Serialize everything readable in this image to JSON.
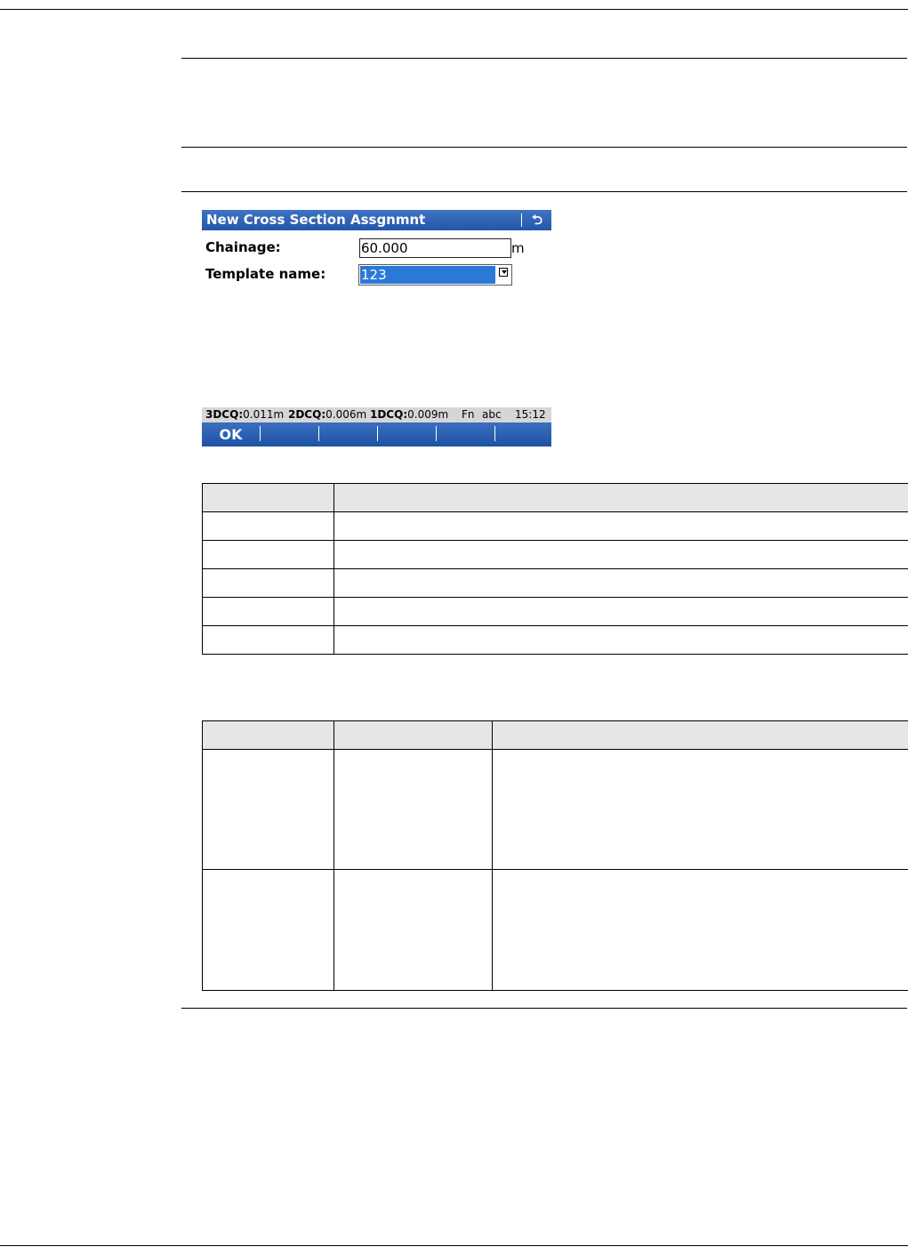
{
  "dialog": {
    "title": "New Cross Section Assgnmnt",
    "back_icon": "return-icon",
    "back_glyph": "⮌"
  },
  "fields": {
    "chainage": {
      "label": "Chainage:",
      "value": "60.000",
      "unit": "m"
    },
    "template_name": {
      "label": "Template name:",
      "value": "123",
      "dropdown_icon": "dropdown-arrow-icon"
    }
  },
  "status_bar": {
    "q3d_label": "3DCQ:",
    "q3d_value": "0.011m",
    "q2d_label": "2DCQ:",
    "q2d_value": "0.006m",
    "q1d_label": "1DCQ:",
    "q1d_value": "0.009m",
    "fn": "Fn",
    "input_mode": "abc",
    "time": "15:12"
  },
  "softkeys": [
    {
      "label": "OK"
    },
    {
      "label": ""
    },
    {
      "label": ""
    },
    {
      "label": ""
    },
    {
      "label": ""
    },
    {
      "label": ""
    }
  ],
  "colors": {
    "title_bar": "#2b5cad",
    "selection": "#2b79d6",
    "status_bar": "#d6d6d6",
    "table_header": "#e6e6e6"
  }
}
